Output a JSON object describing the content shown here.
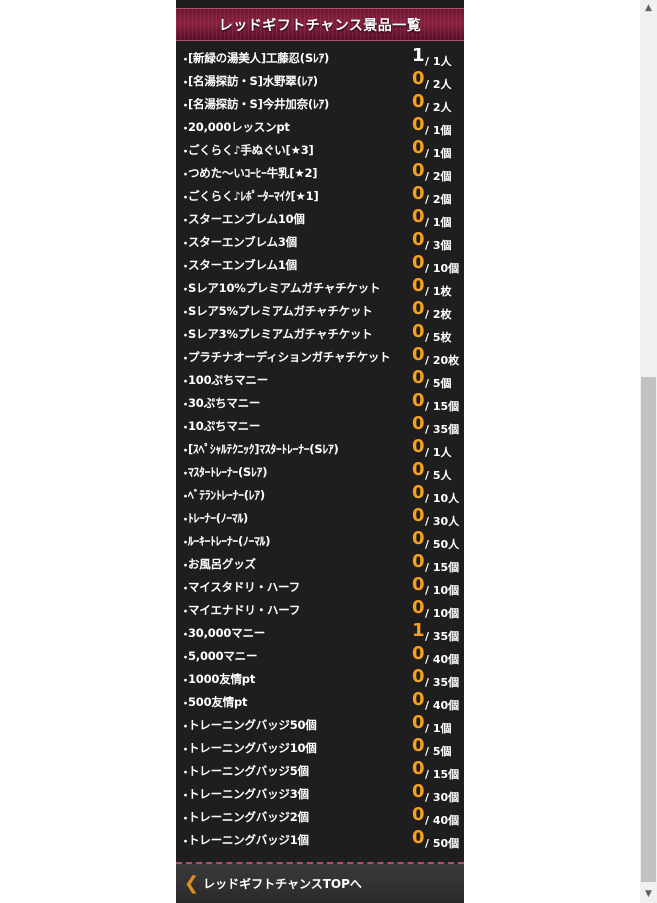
{
  "header": {
    "title": "レッドギフトチャンス景品一覧"
  },
  "bullet": "・",
  "items": [
    {
      "name": "[新緑の湯美人]工藤忍(Sﾚｱ)",
      "count": "1",
      "total": "/ 1人"
    },
    {
      "name": "[名湯探訪・S]水野翠(ﾚｱ)",
      "count": "0",
      "total": "/ 2人"
    },
    {
      "name": "[名湯探訪・S]今井加奈(ﾚｱ)",
      "count": "0",
      "total": "/ 2人"
    },
    {
      "name": "20,000レッスンpt",
      "count": "0",
      "total": "/ 1個"
    },
    {
      "name": "ごくらく♪手ぬぐい[★3]",
      "count": "0",
      "total": "/ 1個"
    },
    {
      "name": "つめた～いｺｰﾋｰ牛乳[★2]",
      "count": "0",
      "total": "/ 2個"
    },
    {
      "name": "ごくらく♪ﾚﾎﾟｰﾀｰﾏｲｸ[★1]",
      "count": "0",
      "total": "/ 2個"
    },
    {
      "name": "スターエンブレム10個",
      "count": "0",
      "total": "/ 1個"
    },
    {
      "name": "スターエンブレム3個",
      "count": "0",
      "total": "/ 3個"
    },
    {
      "name": "スターエンブレム1個",
      "count": "0",
      "total": "/ 10個"
    },
    {
      "name": "Sレア10%プレミアムガチャチケット",
      "count": "0",
      "total": "/ 1枚"
    },
    {
      "name": "Sレア5%プレミアムガチャチケット",
      "count": "0",
      "total": "/ 2枚"
    },
    {
      "name": "Sレア3%プレミアムガチャチケット",
      "count": "0",
      "total": "/ 5枚"
    },
    {
      "name": "プラチナオーディションガチャチケット",
      "count": "0",
      "total": "/ 20枚"
    },
    {
      "name": "100ぷちマニー",
      "count": "0",
      "total": "/ 5個"
    },
    {
      "name": "30ぷちマニー",
      "count": "0",
      "total": "/ 15個"
    },
    {
      "name": "10ぷちマニー",
      "count": "0",
      "total": "/ 35個"
    },
    {
      "name": "[ｽﾍﾟｼｬﾙﾃｸﾆｯｸ]ﾏｽﾀｰﾄﾚｰﾅｰ(Sﾚｱ)",
      "count": "0",
      "total": "/ 1人"
    },
    {
      "name": "ﾏｽﾀｰﾄﾚｰﾅｰ(Sﾚｱ)",
      "count": "0",
      "total": "/ 5人"
    },
    {
      "name": "ﾍﾞﾃﾗﾝﾄﾚｰﾅｰ(ﾚｱ)",
      "count": "0",
      "total": "/ 10人"
    },
    {
      "name": "ﾄﾚｰﾅｰ(ﾉｰﾏﾙ)",
      "count": "0",
      "total": "/ 30人"
    },
    {
      "name": "ﾙｰｷｰﾄﾚｰﾅｰ(ﾉｰﾏﾙ)",
      "count": "0",
      "total": "/ 50人"
    },
    {
      "name": "お風呂グッズ",
      "count": "0",
      "total": "/ 15個"
    },
    {
      "name": "マイスタドリ・ハーフ",
      "count": "0",
      "total": "/ 10個"
    },
    {
      "name": "マイエナドリ・ハーフ",
      "count": "0",
      "total": "/ 10個"
    },
    {
      "name": "30,000マニー",
      "count": "1",
      "total": "/ 35個"
    },
    {
      "name": "5,000マニー",
      "count": "0",
      "total": "/ 40個"
    },
    {
      "name": "1000友情pt",
      "count": "0",
      "total": "/ 35個"
    },
    {
      "name": "500友情pt",
      "count": "0",
      "total": "/ 40個"
    },
    {
      "name": "トレーニングバッジ50個",
      "count": "0",
      "total": "/ 1個"
    },
    {
      "name": "トレーニングバッジ10個",
      "count": "0",
      "total": "/ 5個"
    },
    {
      "name": "トレーニングバッジ5個",
      "count": "0",
      "total": "/ 15個"
    },
    {
      "name": "トレーニングバッジ3個",
      "count": "0",
      "total": "/ 30個"
    },
    {
      "name": "トレーニングバッジ2個",
      "count": "0",
      "total": "/ 40個"
    },
    {
      "name": "トレーニングバッジ1個",
      "count": "0",
      "total": "/ 50個"
    }
  ],
  "footer": {
    "icon": "chevron-left-icon",
    "label": "レッドギフトチャンスTOPへ"
  },
  "scrollbar": {
    "up_icon": "arrow-up-icon",
    "down_icon": "arrow-down-icon",
    "up_glyph": "▲",
    "down_glyph": "▼"
  },
  "colors": {
    "background": "#1e1e1e",
    "header": "#8a2040",
    "count_accent": "#f5a020",
    "count_white": "#ffffff"
  }
}
